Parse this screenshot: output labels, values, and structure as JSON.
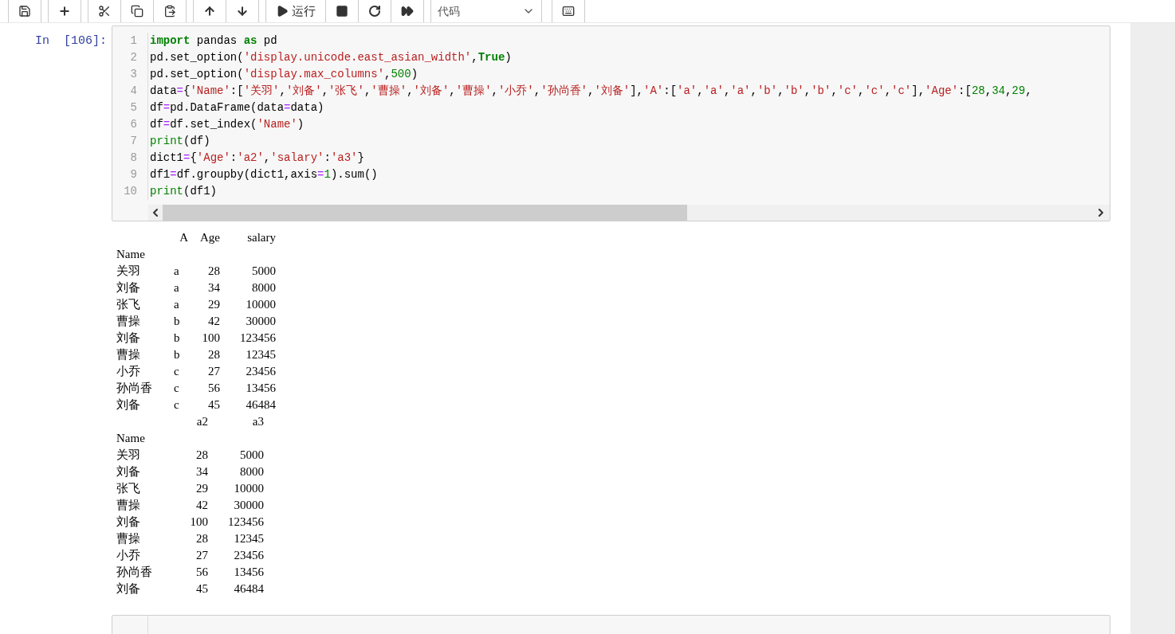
{
  "toolbar": {
    "run_label": "运行",
    "cell_type": "代码"
  },
  "cell": {
    "prompt": "In  [106]:",
    "line_numbers": [
      "1",
      "2",
      "3",
      "4",
      "5",
      "6",
      "7",
      "8",
      "9",
      "10"
    ],
    "lines": [
      [
        {
          "kind": "keyword",
          "text": "import"
        },
        {
          "kind": "plain",
          "text": " pandas "
        },
        {
          "kind": "keyword",
          "text": "as"
        },
        {
          "kind": "plain",
          "text": " pd"
        }
      ],
      [
        {
          "kind": "plain",
          "text": "pd.set_option("
        },
        {
          "kind": "string",
          "text": "'display.unicode.east_asian_width'"
        },
        {
          "kind": "plain",
          "text": ","
        },
        {
          "kind": "keyword",
          "text": "True"
        },
        {
          "kind": "plain",
          "text": ")"
        }
      ],
      [
        {
          "kind": "plain",
          "text": "pd.set_option("
        },
        {
          "kind": "string",
          "text": "'display.max_columns'"
        },
        {
          "kind": "plain",
          "text": ","
        },
        {
          "kind": "number",
          "text": "500"
        },
        {
          "kind": "plain",
          "text": ")"
        }
      ],
      [
        {
          "kind": "plain",
          "text": "data"
        },
        {
          "kind": "operator",
          "text": "="
        },
        {
          "kind": "plain",
          "text": "{"
        },
        {
          "kind": "string",
          "text": "'Name'"
        },
        {
          "kind": "plain",
          "text": ":["
        },
        {
          "kind": "string",
          "text": "'关羽'"
        },
        {
          "kind": "plain",
          "text": ","
        },
        {
          "kind": "string",
          "text": "'刘备'"
        },
        {
          "kind": "plain",
          "text": ","
        },
        {
          "kind": "string",
          "text": "'张飞'"
        },
        {
          "kind": "plain",
          "text": ","
        },
        {
          "kind": "string",
          "text": "'曹操'"
        },
        {
          "kind": "plain",
          "text": ","
        },
        {
          "kind": "string",
          "text": "'刘备'"
        },
        {
          "kind": "plain",
          "text": ","
        },
        {
          "kind": "string",
          "text": "'曹操'"
        },
        {
          "kind": "plain",
          "text": ","
        },
        {
          "kind": "string",
          "text": "'小乔'"
        },
        {
          "kind": "plain",
          "text": ","
        },
        {
          "kind": "string",
          "text": "'孙尚香'"
        },
        {
          "kind": "plain",
          "text": ","
        },
        {
          "kind": "string",
          "text": "'刘备'"
        },
        {
          "kind": "plain",
          "text": "],"
        },
        {
          "kind": "string",
          "text": "'A'"
        },
        {
          "kind": "plain",
          "text": ":["
        },
        {
          "kind": "string",
          "text": "'a'"
        },
        {
          "kind": "plain",
          "text": ","
        },
        {
          "kind": "string",
          "text": "'a'"
        },
        {
          "kind": "plain",
          "text": ","
        },
        {
          "kind": "string",
          "text": "'a'"
        },
        {
          "kind": "plain",
          "text": ","
        },
        {
          "kind": "string",
          "text": "'b'"
        },
        {
          "kind": "plain",
          "text": ","
        },
        {
          "kind": "string",
          "text": "'b'"
        },
        {
          "kind": "plain",
          "text": ","
        },
        {
          "kind": "string",
          "text": "'b'"
        },
        {
          "kind": "plain",
          "text": ","
        },
        {
          "kind": "string",
          "text": "'c'"
        },
        {
          "kind": "plain",
          "text": ","
        },
        {
          "kind": "string",
          "text": "'c'"
        },
        {
          "kind": "plain",
          "text": ","
        },
        {
          "kind": "string",
          "text": "'c'"
        },
        {
          "kind": "plain",
          "text": "],"
        },
        {
          "kind": "string",
          "text": "'Age'"
        },
        {
          "kind": "plain",
          "text": ":["
        },
        {
          "kind": "number",
          "text": "28"
        },
        {
          "kind": "plain",
          "text": ","
        },
        {
          "kind": "number",
          "text": "34"
        },
        {
          "kind": "plain",
          "text": ","
        },
        {
          "kind": "number",
          "text": "29"
        },
        {
          "kind": "plain",
          "text": ","
        }
      ],
      [
        {
          "kind": "plain",
          "text": "df"
        },
        {
          "kind": "operator",
          "text": "="
        },
        {
          "kind": "plain",
          "text": "pd.DataFrame(data"
        },
        {
          "kind": "operator",
          "text": "="
        },
        {
          "kind": "plain",
          "text": "data)"
        }
      ],
      [
        {
          "kind": "plain",
          "text": "df"
        },
        {
          "kind": "operator",
          "text": "="
        },
        {
          "kind": "plain",
          "text": "df.set_index("
        },
        {
          "kind": "string",
          "text": "'Name'"
        },
        {
          "kind": "plain",
          "text": ")"
        }
      ],
      [
        {
          "kind": "builtin",
          "text": "print"
        },
        {
          "kind": "plain",
          "text": "(df)"
        }
      ],
      [
        {
          "kind": "plain",
          "text": "dict1"
        },
        {
          "kind": "operator",
          "text": "="
        },
        {
          "kind": "plain",
          "text": "{"
        },
        {
          "kind": "string",
          "text": "'Age'"
        },
        {
          "kind": "plain",
          "text": ":"
        },
        {
          "kind": "string",
          "text": "'a2'"
        },
        {
          "kind": "plain",
          "text": ","
        },
        {
          "kind": "string",
          "text": "'salary'"
        },
        {
          "kind": "plain",
          "text": ":"
        },
        {
          "kind": "string",
          "text": "'a3'"
        },
        {
          "kind": "plain",
          "text": "}"
        }
      ],
      [
        {
          "kind": "plain",
          "text": "df1"
        },
        {
          "kind": "operator",
          "text": "="
        },
        {
          "kind": "plain",
          "text": "df.groupby(dict1,axis"
        },
        {
          "kind": "operator",
          "text": "="
        },
        {
          "kind": "number",
          "text": "1"
        },
        {
          "kind": "plain",
          "text": ").sum()"
        }
      ],
      [
        {
          "kind": "builtin",
          "text": "print"
        },
        {
          "kind": "plain",
          "text": "(df1)"
        }
      ]
    ],
    "outputs": [
      {
        "columns": [
          "A",
          "Age",
          "salary"
        ],
        "index_name": "Name",
        "rows": [
          {
            "index": "关羽",
            "values": [
              "a",
              "28",
              "5000"
            ]
          },
          {
            "index": "刘备",
            "values": [
              "a",
              "34",
              "8000"
            ]
          },
          {
            "index": "张飞",
            "values": [
              "a",
              "29",
              "10000"
            ]
          },
          {
            "index": "曹操",
            "values": [
              "b",
              "42",
              "30000"
            ]
          },
          {
            "index": "刘备",
            "values": [
              "b",
              "100",
              "123456"
            ]
          },
          {
            "index": "曹操",
            "values": [
              "b",
              "28",
              "12345"
            ]
          },
          {
            "index": "小乔",
            "values": [
              "c",
              "27",
              "23456"
            ]
          },
          {
            "index": "孙尚香",
            "values": [
              "c",
              "56",
              "13456"
            ]
          },
          {
            "index": "刘备",
            "values": [
              "c",
              "45",
              "46484"
            ]
          }
        ]
      },
      {
        "columns": [
          "a2",
          "a3"
        ],
        "index_name": "Name",
        "rows": [
          {
            "index": "关羽",
            "values": [
              "28",
              "5000"
            ]
          },
          {
            "index": "刘备",
            "values": [
              "34",
              "8000"
            ]
          },
          {
            "index": "张飞",
            "values": [
              "29",
              "10000"
            ]
          },
          {
            "index": "曹操",
            "values": [
              "42",
              "30000"
            ]
          },
          {
            "index": "刘备",
            "values": [
              "100",
              "123456"
            ]
          },
          {
            "index": "曹操",
            "values": [
              "28",
              "12345"
            ]
          },
          {
            "index": "小乔",
            "values": [
              "27",
              "23456"
            ]
          },
          {
            "index": "孙尚香",
            "values": [
              "56",
              "13456"
            ]
          },
          {
            "index": "刘备",
            "values": [
              "45",
              "46484"
            ]
          }
        ]
      }
    ]
  }
}
